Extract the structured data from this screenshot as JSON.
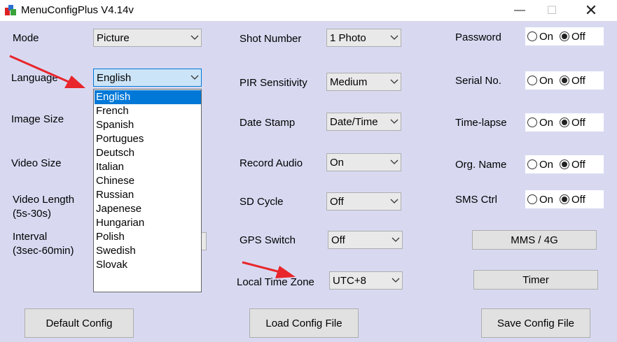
{
  "window": {
    "title": "MenuConfigPlus V4.14v"
  },
  "left": {
    "mode_label": "Mode",
    "mode_value": "Picture",
    "language_label": "Language",
    "language_value": "English",
    "image_size_label": "Image Size",
    "video_size_label": "Video Size",
    "video_length_label": "Video Length\n(5s-30s)",
    "interval_label": "Interval\n(3sec-60min)"
  },
  "language_options": [
    "English",
    "French",
    "Spanish",
    "Portugues",
    "Deutsch",
    "Italian",
    "Chinese",
    "Russian",
    "Japenese",
    "Hungarian",
    "Polish",
    "Swedish",
    "Slovak"
  ],
  "middle": {
    "shot_number_label": "Shot Number",
    "shot_number_value": "1 Photo",
    "pir_label": "PIR Sensitivity",
    "pir_value": "Medium",
    "date_stamp_label": "Date Stamp",
    "date_stamp_value": "Date/Time",
    "record_audio_label": "Record Audio",
    "record_audio_value": "On",
    "sd_cycle_label": "SD Cycle",
    "sd_cycle_value": "Off",
    "gps_label": "GPS Switch",
    "gps_value": "Off",
    "timezone_label": "Local Time Zone",
    "timezone_value": "UTC+8"
  },
  "right": {
    "on_label": "On",
    "off_label": "Off",
    "password_label": "Password",
    "serial_label": "Serial No.",
    "timelapse_label": "Time-lapse",
    "orgname_label": "Org. Name",
    "smsctrl_label": "SMS Ctrl",
    "mms_button": "MMS / 4G",
    "timer_button": "Timer"
  },
  "bottom": {
    "default_config": "Default Config",
    "load_config": "Load Config File",
    "save_config": "Save Config File"
  },
  "colors": {
    "client_bg": "#d8d9f1",
    "selection": "#0078d7",
    "arrow": "#e8262b"
  }
}
